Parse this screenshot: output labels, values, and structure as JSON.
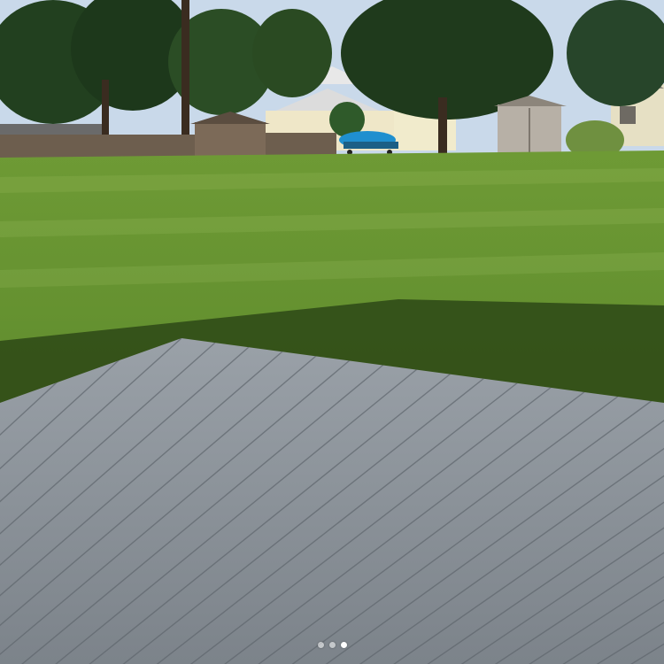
{
  "viewer": {
    "image_count": 3,
    "active_index": 2
  },
  "colors": {
    "sky": "#c9d9ea",
    "lawn": "#5d8a2c",
    "lawn_light": "#7fa843",
    "shadow": "#2f4a17",
    "deck": "#8d949b",
    "deck_dark": "#5f666d",
    "tree": "#22401f",
    "boat_cover": "#1f8fcf",
    "shed": "#b7b0a6",
    "house": "#efe7c8",
    "roof": "#6f7478"
  }
}
